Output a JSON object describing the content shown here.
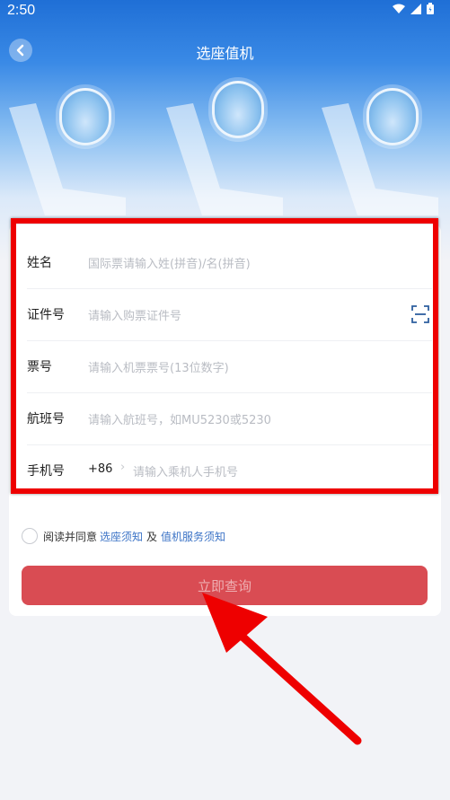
{
  "status_bar": {
    "time": "2:50",
    "icons": [
      "wifi-icon",
      "signal-icon",
      "battery-icon"
    ]
  },
  "header": {
    "title": "选座值机",
    "back_icon": "chevron-left-icon"
  },
  "form": {
    "rows": [
      {
        "label": "姓名",
        "placeholder": "国际票请输入姓(拼音)/名(拼音)"
      },
      {
        "label": "证件号",
        "placeholder": "请输入购票证件号",
        "action_icon": "scan-icon"
      },
      {
        "label": "票号",
        "placeholder": "请输入机票票号(13位数字)"
      },
      {
        "label": "航班号",
        "placeholder": "请输入航班号，如MU5230或5230"
      },
      {
        "label": "手机号",
        "prefix": "+86",
        "placeholder": "请输入乘机人手机号"
      }
    ]
  },
  "agreement": {
    "prefix": "阅读并同意",
    "link1": "选座须知",
    "joiner": "及",
    "link2": "值机服务须知"
  },
  "submit_label": "立即查询",
  "colors": {
    "header_blue": "#1f6fd6",
    "submit_red": "#d94c53",
    "link_blue": "#3b73c6",
    "annotation_red": "#ee0000"
  }
}
